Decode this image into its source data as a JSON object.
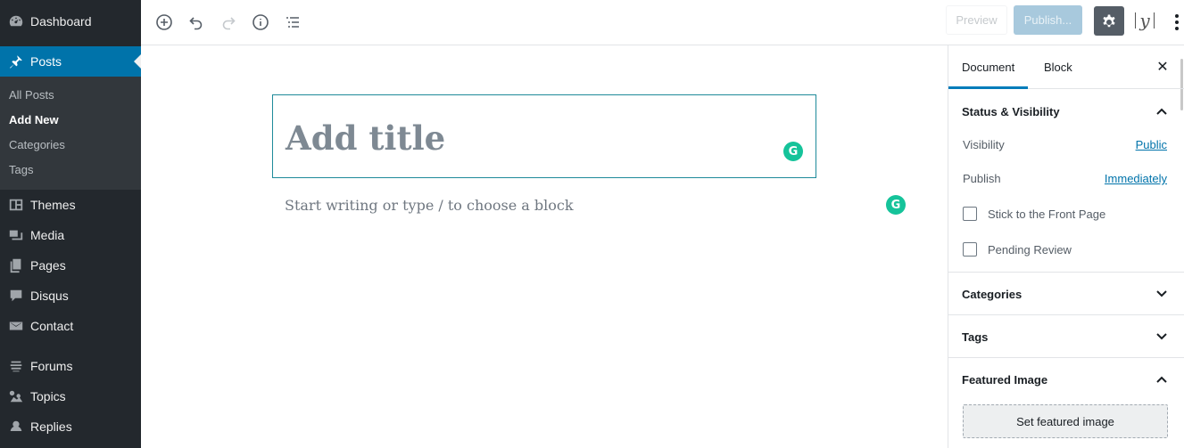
{
  "admin_menu": {
    "dashboard": {
      "label": "Dashboard",
      "icon": "dashboard-icon"
    },
    "posts": {
      "label": "Posts",
      "icon": "pin-icon"
    },
    "posts_submenu": [
      "All Posts",
      "Add New",
      "Categories",
      "Tags"
    ],
    "themes": {
      "label": "Themes",
      "icon": "themes-icon"
    },
    "media": {
      "label": "Media",
      "icon": "media-icon"
    },
    "pages": {
      "label": "Pages",
      "icon": "pages-icon"
    },
    "disqus": {
      "label": "Disqus",
      "icon": "comment-icon"
    },
    "contact": {
      "label": "Contact",
      "icon": "mail-icon"
    },
    "forums": {
      "label": "Forums",
      "icon": "forums-icon"
    },
    "topics": {
      "label": "Topics",
      "icon": "topics-icon"
    },
    "replies": {
      "label": "Replies",
      "icon": "replies-icon"
    },
    "active_color": "#0073aa",
    "background": "#23282d"
  },
  "toolbar": {
    "preview_label": "Preview",
    "publish_label": "Publish...",
    "yoast_label": "y"
  },
  "editor": {
    "title_placeholder": "Add title",
    "body_placeholder": "Start writing or type / to choose a block",
    "grammarly_glyph": "G"
  },
  "sidebar": {
    "tabs": [
      "Document",
      "Block"
    ],
    "close_glyph": "✕",
    "status_visibility": {
      "heading": "Status & Visibility",
      "visibility_label": "Visibility",
      "visibility_value": "Public",
      "publish_label": "Publish",
      "publish_value": "Immediately",
      "stick_label": "Stick to the Front Page",
      "pending_label": "Pending Review"
    },
    "categories_heading": "Categories",
    "tags_heading": "Tags",
    "featured_image": {
      "heading": "Featured Image",
      "button_label": "Set featured image"
    }
  }
}
